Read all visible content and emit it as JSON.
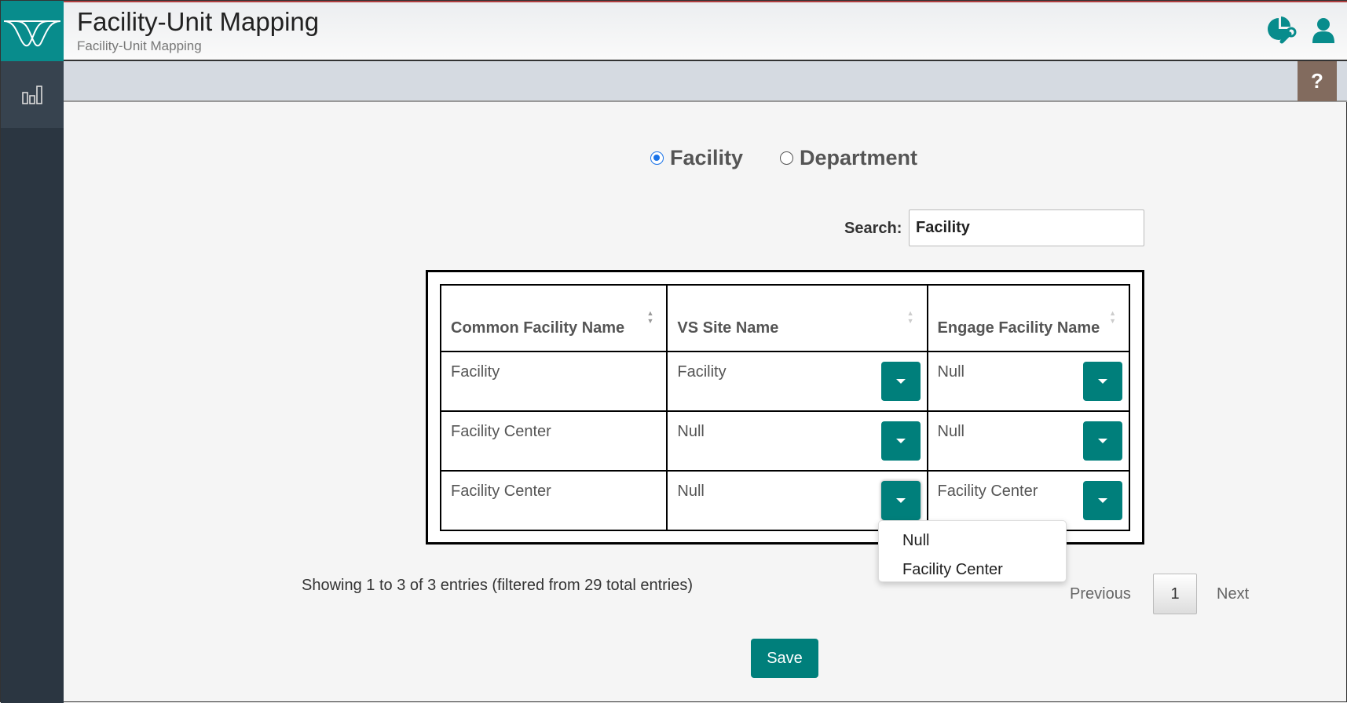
{
  "header": {
    "title": "Facility-Unit Mapping",
    "subtitle": "Facility-Unit Mapping",
    "help_label": "?"
  },
  "mode": {
    "options": [
      {
        "label": "Facility",
        "selected": true
      },
      {
        "label": "Department",
        "selected": false
      }
    ]
  },
  "search": {
    "label": "Search:",
    "value": "Facility"
  },
  "table": {
    "headers": [
      "Common Facility Name",
      "VS Site Name",
      "Engage Facility Name"
    ],
    "rows": [
      [
        "Facility",
        "Facility",
        "Null"
      ],
      [
        "Facility Center",
        "Null",
        "Null"
      ],
      [
        "Facility Center",
        "Null",
        "Facility Center"
      ]
    ]
  },
  "dropdown_menu": {
    "options": [
      "Null",
      "Facility Center"
    ]
  },
  "footer": {
    "info": "Showing 1 to 3 of 3 entries (filtered from 29 total entries)",
    "previous": "Previous",
    "page": "1",
    "next": "Next",
    "save": "Save"
  },
  "colors": {
    "accent": "#007f7b",
    "help": "#826b5e",
    "sidebar": "#2b3641"
  }
}
